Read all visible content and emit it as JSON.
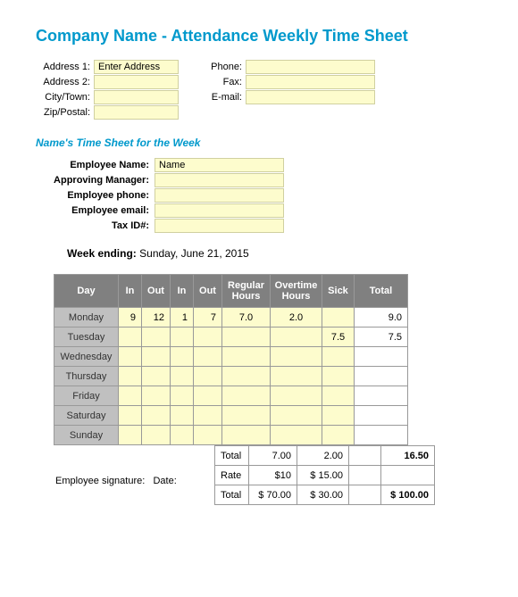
{
  "title": "Company Name - Attendance Weekly Time Sheet",
  "address": {
    "labels": {
      "addr1": "Address 1:",
      "addr2": "Address 2:",
      "city": "City/Town:",
      "zip": "Zip/Postal:",
      "phone": "Phone:",
      "fax": "Fax:",
      "email": "E-mail:"
    },
    "values": {
      "addr1": "Enter Address",
      "addr2": "",
      "city": "",
      "zip": "",
      "phone": "",
      "fax": "",
      "email": ""
    }
  },
  "subtitle": "Name's Time Sheet for the Week",
  "employee": {
    "labels": {
      "name": "Employee Name:",
      "manager": "Approving Manager:",
      "phone": "Employee phone:",
      "email": "Employee email:",
      "tax": "Tax ID#:"
    },
    "values": {
      "name": "Name",
      "manager": "",
      "phone": "",
      "email": "",
      "tax": ""
    }
  },
  "week_ending": {
    "label": "Week ending:",
    "value": "Sunday, June 21, 2015"
  },
  "table": {
    "headers": {
      "day": "Day",
      "in1": "In",
      "out1": "Out",
      "in2": "In",
      "out2": "Out",
      "regular": "Regular Hours",
      "overtime": "Overtime Hours",
      "sick": "Sick",
      "total": "Total"
    },
    "rows": [
      {
        "day": "Monday",
        "in1": "9",
        "out1": "12",
        "in2": "1",
        "out2": "7",
        "regular": "7.0",
        "overtime": "2.0",
        "sick": "",
        "total": "9.0"
      },
      {
        "day": "Tuesday",
        "in1": "",
        "out1": "",
        "in2": "",
        "out2": "",
        "regular": "",
        "overtime": "",
        "sick": "7.5",
        "total": "7.5"
      },
      {
        "day": "Wednesday",
        "in1": "",
        "out1": "",
        "in2": "",
        "out2": "",
        "regular": "",
        "overtime": "",
        "sick": "",
        "total": ""
      },
      {
        "day": "Thursday",
        "in1": "",
        "out1": "",
        "in2": "",
        "out2": "",
        "regular": "",
        "overtime": "",
        "sick": "",
        "total": ""
      },
      {
        "day": "Friday",
        "in1": "",
        "out1": "",
        "in2": "",
        "out2": "",
        "regular": "",
        "overtime": "",
        "sick": "",
        "total": ""
      },
      {
        "day": "Saturday",
        "in1": "",
        "out1": "",
        "in2": "",
        "out2": "",
        "regular": "",
        "overtime": "",
        "sick": "",
        "total": ""
      },
      {
        "day": "Sunday",
        "in1": "",
        "out1": "",
        "in2": "",
        "out2": "",
        "regular": "",
        "overtime": "",
        "sick": "",
        "total": ""
      }
    ]
  },
  "summary": {
    "labels": {
      "total": "Total",
      "rate": "Rate",
      "grand": "Total"
    },
    "totals": {
      "regular": "7.00",
      "overtime": "2.00",
      "sick": "",
      "total": "16.50"
    },
    "rates": {
      "regular": "$10",
      "overtime": "$   15.00",
      "sick": "",
      "total": ""
    },
    "grand": {
      "regular": "$  70.00",
      "overtime": "$   30.00",
      "sick": "",
      "total": "$  100.00"
    }
  },
  "signature": {
    "employee": "Employee signature:",
    "date": "Date:"
  }
}
